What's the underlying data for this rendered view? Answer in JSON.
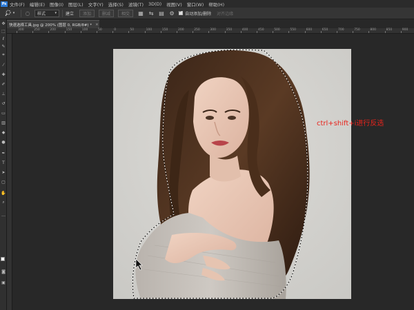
{
  "menu": {
    "items": [
      "文件(F)",
      "编辑(E)",
      "图像(I)",
      "图层(L)",
      "文字(Y)",
      "选择(S)",
      "滤镜(T)",
      "3D(D)",
      "视图(V)",
      "窗口(W)",
      "帮助(H)"
    ]
  },
  "options": {
    "preset_label": "",
    "style_value": "样式",
    "new_label": "建立",
    "union_label": "添加",
    "subtract_label": "删减",
    "intersect_label": "相交",
    "auto_add_label": "自动添加/删除",
    "align_edges_label": "对齐边缘"
  },
  "document": {
    "tab_title": "快速选择工具.jpg @ 200% (图层 0, RGB/8#) *",
    "close_glyph": "×"
  },
  "ruler": {
    "ticks": [
      "300",
      "250",
      "200",
      "150",
      "100",
      "50",
      "0",
      "50",
      "100",
      "150",
      "200",
      "250",
      "300",
      "350",
      "400",
      "450",
      "500",
      "550",
      "600",
      "650",
      "700",
      "750",
      "800",
      "850",
      "900",
      "950"
    ]
  },
  "annotation": {
    "text": "ctrl+shift+i进行反选",
    "color": "#e8241c"
  },
  "colors": {
    "app_bg": "#282828",
    "panel": "#353535",
    "photo_bg": "#d7d6d2"
  }
}
